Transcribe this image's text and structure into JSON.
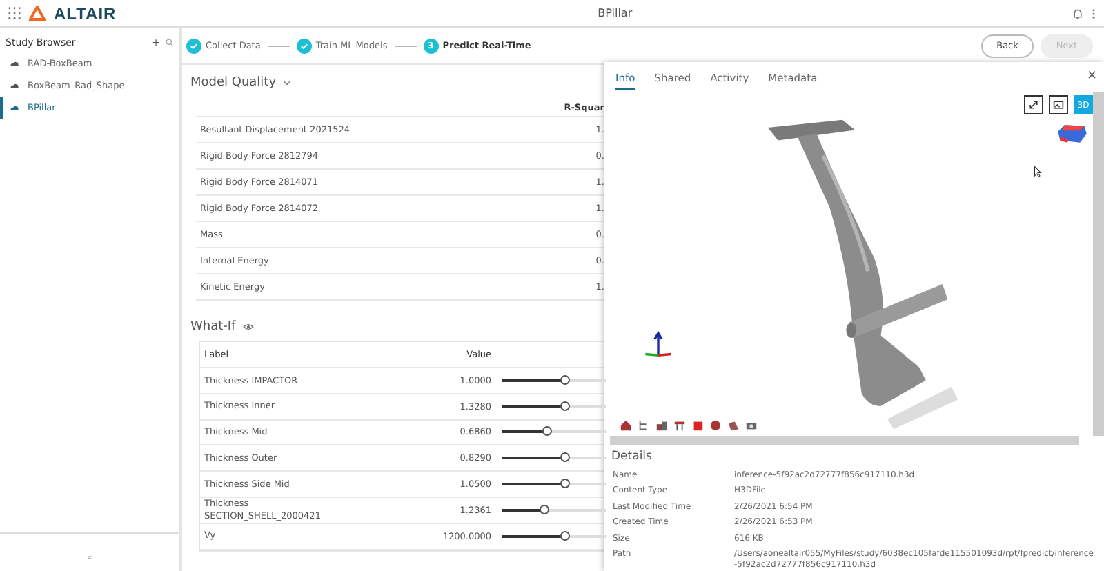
{
  "app": {
    "brand": "ALTAIR",
    "title": "BPillar"
  },
  "sidebar": {
    "title": "Study Browser",
    "add": "+",
    "collapse": "«",
    "items": [
      {
        "label": "RAD-BoxBeam",
        "selected": false
      },
      {
        "label": "BoxBeam_Rad_Shape",
        "selected": false
      },
      {
        "label": "BPillar",
        "selected": true
      }
    ]
  },
  "steps": [
    {
      "label": "Collect Data",
      "done": true,
      "selected": false
    },
    {
      "label": "Train ML Models",
      "done": true,
      "selected": false
    },
    {
      "label": "Predict Real-Time",
      "done": false,
      "number": "3",
      "selected": true
    }
  ],
  "buttons": [
    {
      "label": "Back",
      "disabled": false
    },
    {
      "label": "Next",
      "disabled": true
    }
  ],
  "model_quality": {
    "title": "Model Quality",
    "columns": [
      "R-Squar"
    ],
    "rows": [
      {
        "name": "Resultant Displacement 2021524",
        "value": "1."
      },
      {
        "name": "Rigid Body Force 2812794",
        "value": "0."
      },
      {
        "name": "Rigid Body Force 2814071",
        "value": "1."
      },
      {
        "name": "Rigid Body Force 2814072",
        "value": "1."
      },
      {
        "name": "Mass",
        "value": "0."
      },
      {
        "name": "Internal Energy",
        "value": "0."
      },
      {
        "name": "Kinetic Energy",
        "value": "1."
      }
    ]
  },
  "what_if": {
    "title": "What-If",
    "columns": [
      "Label",
      "Value"
    ],
    "rows": [
      {
        "label": "Thickness IMPACTOR",
        "value": "1.0000",
        "level": 0.6
      },
      {
        "label": "Thickness Inner",
        "value": "1.3280",
        "level": 0.6
      },
      {
        "label": "Thickness Mid",
        "value": "0.6860",
        "level": 0.43
      },
      {
        "label": "Thickness Outer",
        "value": "0.8290",
        "level": 0.6
      },
      {
        "label": "Thickness Side Mid",
        "value": "1.0500",
        "level": 0.6
      },
      {
        "label": "Thickness\nSECTION_SHELL_2000421",
        "value": "1.2361",
        "level": 0.4
      },
      {
        "label": "Vy",
        "value": "1200.0000",
        "level": 0.6
      }
    ]
  },
  "panel": {
    "close": "×",
    "tabs": [
      {
        "label": "Info",
        "selected": true
      },
      {
        "label": "Shared",
        "selected": false
      },
      {
        "label": "Activity",
        "selected": false
      },
      {
        "label": "Metadata",
        "selected": false
      }
    ],
    "view_mode": "3D",
    "details_title": "Details",
    "details": [
      {
        "key": "Name",
        "value": "inference-5f92ac2d72777f856c917110.h3d"
      },
      {
        "key": "Content Type",
        "value": "H3DFile"
      },
      {
        "key": "Last Modified Time",
        "value": "2/26/2021 6:54 PM"
      },
      {
        "key": "Created Time",
        "value": "2/26/2021 6:53 PM"
      },
      {
        "key": "Size",
        "value": "616 KB"
      },
      {
        "key": "Path",
        "value": "/Users/aonealtair055/MyFiles/study/6038ec105fafde115501093d/rpt/fpredict/inference-5f92ac2d72777f856c917110.h3d"
      }
    ]
  }
}
